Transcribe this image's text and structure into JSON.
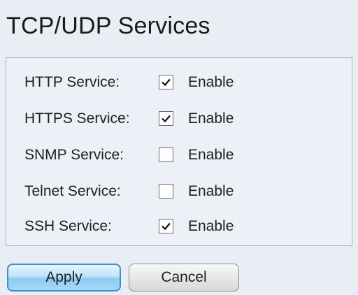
{
  "page": {
    "title": "TCP/UDP Services"
  },
  "services": [
    {
      "label": "HTTP Service:",
      "enable_label": "Enable",
      "checked": true
    },
    {
      "label": "HTTPS Service:",
      "enable_label": "Enable",
      "checked": true
    },
    {
      "label": "SNMP Service:",
      "enable_label": "Enable",
      "checked": false
    },
    {
      "label": "Telnet Service:",
      "enable_label": "Enable",
      "checked": false
    },
    {
      "label": "SSH Service:",
      "enable_label": "Enable",
      "checked": true
    }
  ],
  "buttons": {
    "apply_label": "Apply",
    "cancel_label": "Cancel"
  },
  "icons": {
    "checkmark": "check-icon"
  },
  "colors": {
    "panel_background": "#e9eef4",
    "apply_accent": "#3f8fc9"
  }
}
